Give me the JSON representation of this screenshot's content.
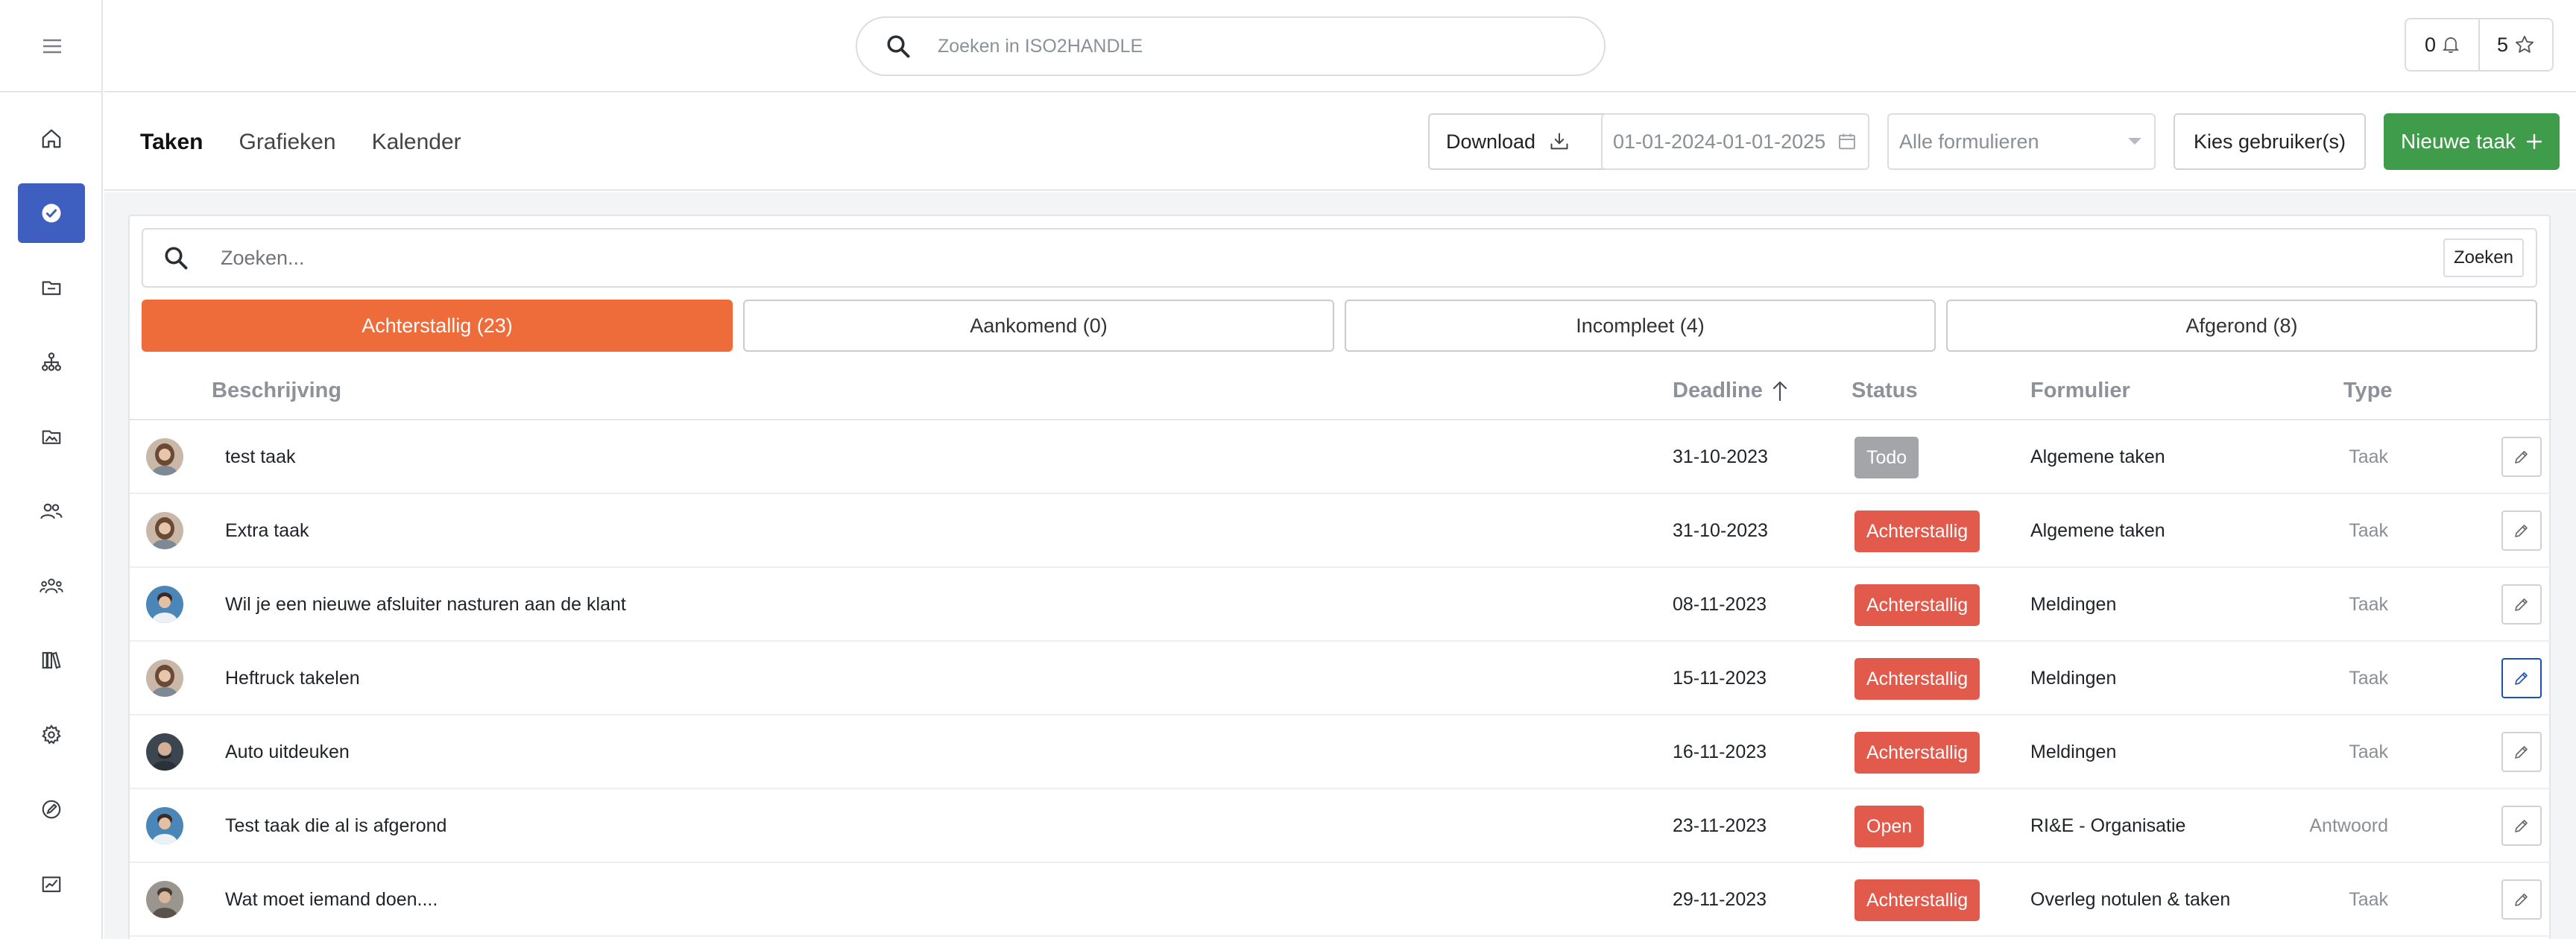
{
  "app": {
    "search_placeholder": "Zoeken in ISO2HANDLE",
    "notifications_count": "0",
    "favorites_count": "5"
  },
  "sidebar": {
    "items": [
      {
        "icon": "home-icon"
      },
      {
        "icon": "check-circle-icon",
        "active": true
      },
      {
        "icon": "folder-icon"
      },
      {
        "icon": "org-chart-icon"
      },
      {
        "icon": "image-folder-icon"
      },
      {
        "icon": "users-icon"
      },
      {
        "icon": "group-icon"
      },
      {
        "icon": "books-icon"
      },
      {
        "icon": "gear-icon"
      },
      {
        "icon": "edit-pen-icon"
      },
      {
        "icon": "analytics-icon"
      }
    ]
  },
  "subheader": {
    "tabs": [
      {
        "label": "Taken",
        "active": true
      },
      {
        "label": "Grafieken"
      },
      {
        "label": "Kalender"
      }
    ],
    "download_label": "Download",
    "date_range": "01-01-2024-01-01-2025",
    "forms_select": "Alle formulieren",
    "choose_user_label": "Kies gebruiker(s)",
    "new_task_label": "Nieuwe taak"
  },
  "list": {
    "search_placeholder": "Zoeken...",
    "search_button": "Zoeken",
    "filters": [
      {
        "label": "Achterstallig (23)",
        "active": true
      },
      {
        "label": "Aankomend (0)"
      },
      {
        "label": "Incompleet (4)"
      },
      {
        "label": "Afgerond (8)"
      }
    ],
    "columns": {
      "description": "Beschrijving",
      "deadline": "Deadline",
      "status": "Status",
      "form": "Formulier",
      "type": "Type"
    },
    "rows": [
      {
        "description": "test taak",
        "deadline": "31-10-2023",
        "status": "Todo",
        "status_kind": "todo",
        "form": "Algemene taken",
        "type": "Taak"
      },
      {
        "description": "Extra taak",
        "deadline": "31-10-2023",
        "status": "Achterstallig",
        "status_kind": "late",
        "form": "Algemene taken",
        "type": "Taak"
      },
      {
        "description": "Wil je een nieuwe afsluiter nasturen aan de klant",
        "deadline": "08-11-2023",
        "status": "Achterstallig",
        "status_kind": "late",
        "form": "Meldingen",
        "type": "Taak"
      },
      {
        "description": "Heftruck takelen",
        "deadline": "15-11-2023",
        "status": "Achterstallig",
        "status_kind": "late",
        "form": "Meldingen",
        "type": "Taak"
      },
      {
        "description": "Auto uitdeuken",
        "deadline": "16-11-2023",
        "status": "Achterstallig",
        "status_kind": "late",
        "form": "Meldingen",
        "type": "Taak"
      },
      {
        "description": "Test taak die al is afgerond",
        "deadline": "23-11-2023",
        "status": "Open",
        "status_kind": "open",
        "form": "RI&E - Organisatie",
        "type": "Antwoord"
      },
      {
        "description": "Wat moet iemand doen....",
        "deadline": "29-11-2023",
        "status": "Achterstallig",
        "status_kind": "late",
        "form": "Overleg notulen & taken",
        "type": "Taak"
      }
    ]
  },
  "colors": {
    "accent_blue": "#3e5fbf",
    "orange": "#ee6c3a",
    "green": "#3f9c4a",
    "red": "#e25a4c",
    "gray_badge": "#a3a5a8"
  }
}
